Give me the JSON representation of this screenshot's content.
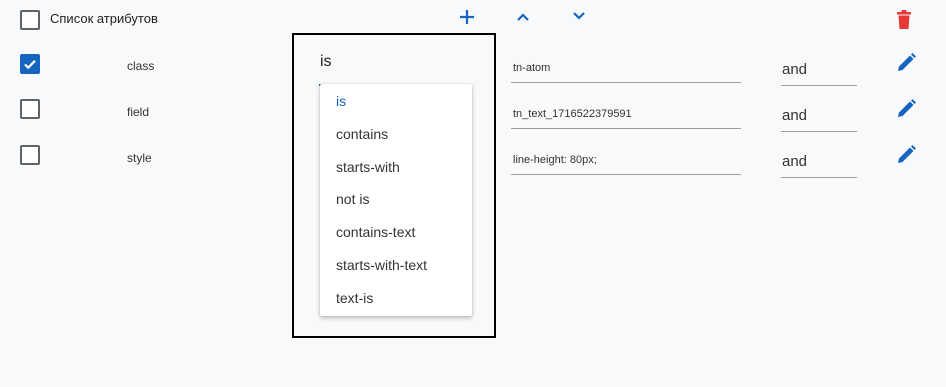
{
  "header": {
    "title": "Список атрибутов",
    "select_all_checked": false,
    "add_icon": "plus-icon",
    "move_up_icon": "chevron-up-icon",
    "move_down_icon": "chevron-down-icon",
    "delete_icon": "trash-icon"
  },
  "rows": [
    {
      "checked": true,
      "name": "class",
      "value": "tn-atom",
      "logic": "and",
      "edit_icon": "pencil-icon"
    },
    {
      "checked": false,
      "name": "field",
      "value": "tn_text_1716522379591",
      "logic": "and",
      "edit_icon": "pencil-icon"
    },
    {
      "checked": false,
      "name": "style",
      "value": "line-height: 80px;",
      "logic": "and",
      "edit_icon": "pencil-icon"
    }
  ],
  "operator_select": {
    "value": "is",
    "options": [
      "is",
      "contains",
      "starts-with",
      "not is",
      "contains-text",
      "starts-with-text",
      "text-is"
    ],
    "selected_index": 0
  },
  "colors": {
    "accent": "#1565c0",
    "delete": "#e53935",
    "checkbox_border": "#5f6368",
    "background": "#f8f9fb"
  }
}
